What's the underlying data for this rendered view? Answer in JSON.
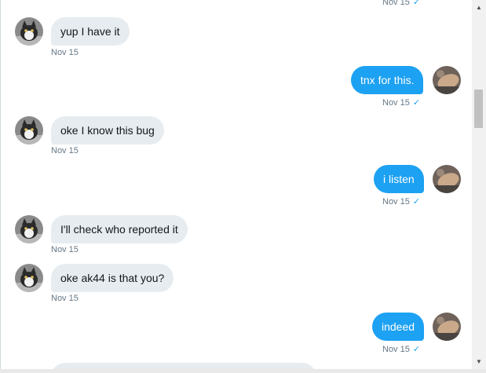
{
  "messages": [
    {
      "dir": "out",
      "text": "",
      "time": "Nov 15",
      "read": "✓"
    },
    {
      "dir": "in",
      "text": "yup I have it",
      "time": "Nov 15"
    },
    {
      "dir": "out",
      "text": "tnx for this.",
      "time": "Nov 15",
      "read": "✓"
    },
    {
      "dir": "in",
      "text": "oke I know this bug",
      "time": "Nov 15"
    },
    {
      "dir": "out",
      "text": "i listen",
      "time": "Nov 15",
      "read": "✓"
    },
    {
      "dir": "in",
      "text": "I'll check who reported it",
      "time": "Nov 15"
    },
    {
      "dir": "in",
      "text": "oke ak44 is that you?",
      "time": "Nov 15"
    },
    {
      "dir": "out",
      "text": "indeed",
      "time": "Nov 15",
      "read": "✓"
    },
    {
      "dir": "in",
      "text": "",
      "time": ""
    }
  ],
  "scrollbar": {
    "up_icon": "▲",
    "down_icon": "▼"
  },
  "colors": {
    "incoming_bubble": "#e6ecf0",
    "outgoing_bubble": "#1da1f2",
    "timestamp": "#657786",
    "check": "#1da1f2"
  }
}
